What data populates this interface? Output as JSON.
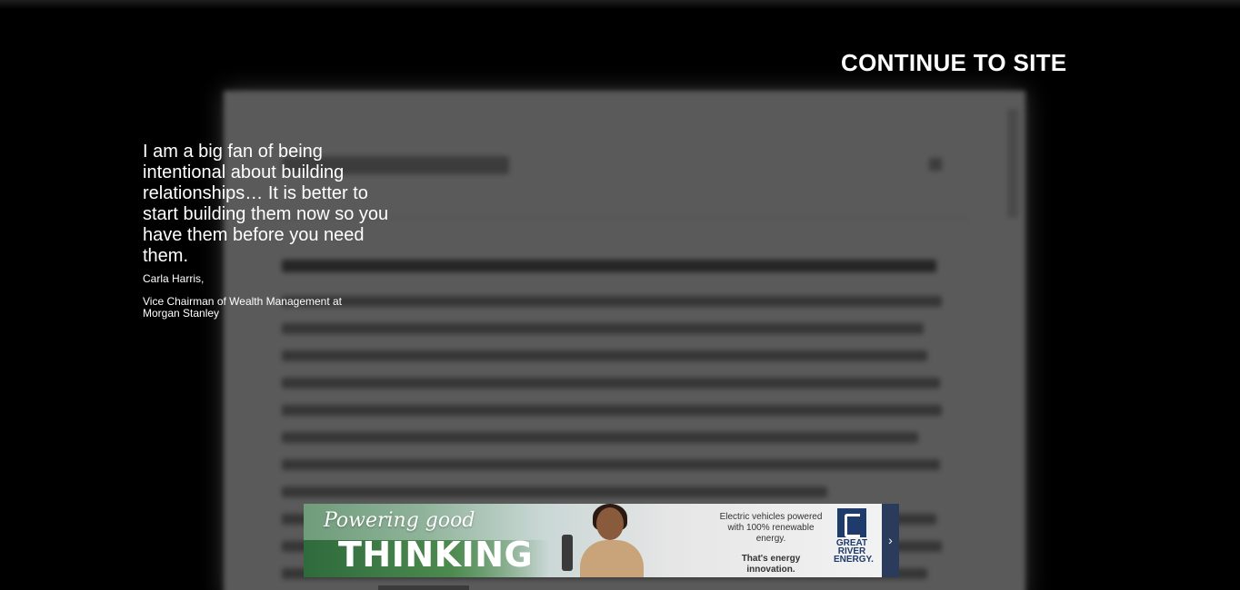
{
  "overlay": {
    "continue_label": "CONTINUE TO SITE"
  },
  "quote": {
    "text": "I am a big fan of being intentional about building relationships… It is better to start building them now so you have them before you need them.",
    "author": "Carla Harris,",
    "role": "Vice Chairman of Wealth Management at Morgan Stanley"
  },
  "ad": {
    "tagline": "Powering good",
    "headline": "THINKING",
    "copy": "Electric vehicles powered with 100% renewable energy.",
    "subcopy": "That's energy innovation.",
    "brand_lines": [
      "GREAT",
      "RIVER",
      "ENERGY."
    ],
    "next_arrow": "›",
    "colors": {
      "green": "#2f6a3c",
      "navy": "#1f3b6b"
    }
  },
  "colors": {
    "backdrop": "#000000",
    "overlay_text": "#ffffff"
  }
}
